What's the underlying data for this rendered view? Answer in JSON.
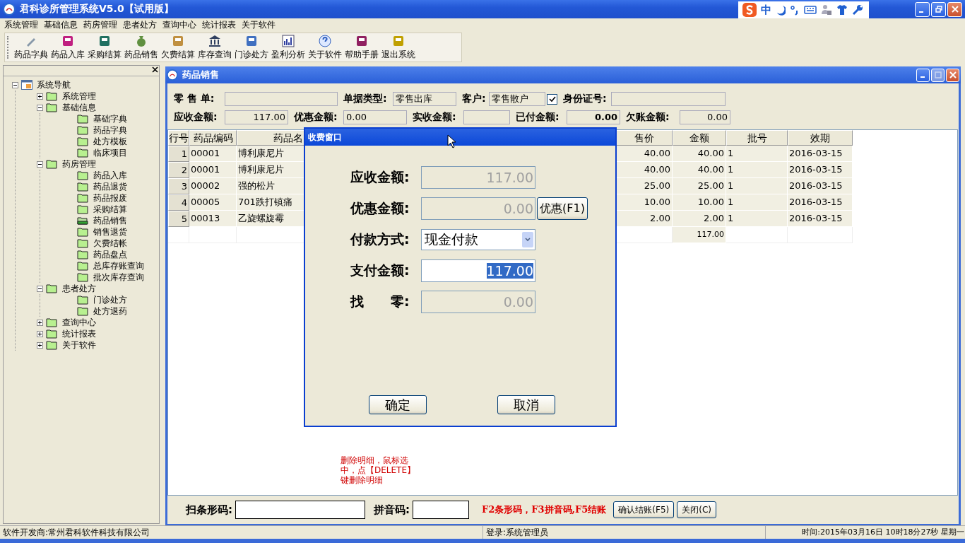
{
  "window": {
    "title": "君科诊所管理系统V5.0【试用版】"
  },
  "ime_bar": {
    "mode": "中"
  },
  "menu": [
    "系统管理",
    "基础信息",
    "药房管理",
    "患者处方",
    "查询中心",
    "统计报表",
    "关于软件"
  ],
  "toolbar": [
    "药品字典",
    "药品入库",
    "采购结算",
    "药品销售",
    "欠费结算",
    "库存查询",
    "门诊处方",
    "盈利分析",
    "关于软件",
    "帮助手册",
    "退出系统"
  ],
  "nav": {
    "label": "系统导航",
    "expanded": true,
    "children": [
      {
        "label": "系统管理",
        "expanded": false,
        "selected": false
      },
      {
        "label": "基础信息",
        "expanded": true,
        "selected": false,
        "children": [
          {
            "label": "基础字典",
            "selected": false
          },
          {
            "label": "药品字典",
            "selected": false
          },
          {
            "label": "处方模板",
            "selected": false
          },
          {
            "label": "临床项目",
            "selected": false
          }
        ]
      },
      {
        "label": "药房管理",
        "expanded": true,
        "selected": false,
        "children": [
          {
            "label": "药品入库",
            "selected": false
          },
          {
            "label": "药品退货",
            "selected": false
          },
          {
            "label": "药品报废",
            "selected": false
          },
          {
            "label": "采购结算",
            "selected": false
          },
          {
            "label": "药品销售",
            "selected": true
          },
          {
            "label": "销售退货",
            "selected": false
          },
          {
            "label": "欠费结帐",
            "selected": false
          },
          {
            "label": "药品盘点",
            "selected": false
          },
          {
            "label": "总库存账查询",
            "selected": false
          },
          {
            "label": "批次库存查询",
            "selected": false
          }
        ]
      },
      {
        "label": "患者处方",
        "expanded": true,
        "selected": false,
        "children": [
          {
            "label": "门诊处方",
            "selected": false
          },
          {
            "label": "处方退药",
            "selected": false
          }
        ]
      },
      {
        "label": "查询中心",
        "expanded": false,
        "selected": false
      },
      {
        "label": "统计报表",
        "expanded": false,
        "selected": false
      },
      {
        "label": "关于软件",
        "expanded": false,
        "selected": false
      }
    ]
  },
  "sales_window": {
    "title": "药品销售",
    "header_rows": [
      [
        {
          "kind": "text_field",
          "label": "零 售 单:"
        },
        {
          "kind": "text_field",
          "label": "单据类型:",
          "value": "零售出库"
        },
        {
          "kind": "text_field",
          "label": "客户:",
          "value": "零售散户"
        },
        {
          "kind": "checkbox",
          "checked": true
        },
        {
          "kind": "text_field",
          "label": "身份证号:"
        }
      ],
      [
        {
          "kind": "amount_field",
          "label": "应收金额:",
          "value": "117.00"
        },
        {
          "kind": "text_field",
          "label": "优惠金额:",
          "value": "0.00"
        },
        {
          "kind": "text_field",
          "label": "实收金额:"
        },
        {
          "kind": "bold_amount_field",
          "label": "已付金额:",
          "value": "0.00"
        },
        {
          "kind": "amount_field",
          "label": "欠账金额:",
          "value": "0.00"
        }
      ]
    ],
    "table": {
      "columns": [
        "行号",
        "药品编码",
        "药品名",
        "售价",
        "金额",
        "批号",
        "效期"
      ],
      "rows": [
        {
          "no": "1",
          "code": "00001",
          "name": "博利康尼片",
          "price": "40.00",
          "amount": "40.00",
          "batch": "1",
          "expiry": "2016-03-15"
        },
        {
          "no": "2",
          "code": "00001",
          "name": "博利康尼片",
          "price": "40.00",
          "amount": "40.00",
          "batch": "1",
          "expiry": "2016-03-15"
        },
        {
          "no": "3",
          "code": "00002",
          "name": "强的松片",
          "price": "25.00",
          "amount": "25.00",
          "batch": "1",
          "expiry": "2016-03-15"
        },
        {
          "no": "4",
          "code": "00005",
          "name": "701跌打镇痛",
          "price": "10.00",
          "amount": "10.00",
          "batch": "1",
          "expiry": "2016-03-15"
        },
        {
          "no": "5",
          "code": "00013",
          "name": "乙旋螺旋霉",
          "price": "2.00",
          "amount": "2.00",
          "batch": "1",
          "expiry": "2016-03-15"
        }
      ],
      "total": "117.00"
    },
    "note": "删除明细，鼠标选中，点【DELETE】键删除明细",
    "barcode": {
      "label": "扫条形码:"
    },
    "pinyin": {
      "label": "拼音码:"
    },
    "hotkeys": "F2条形码，F3拼音码,F5结账",
    "buttons": [
      "确认结账(F5)",
      "关闭(C)"
    ]
  },
  "payment_dialog": {
    "title": "收费窗口",
    "fields": [
      {
        "kind": "readonly",
        "label": "应收金额:",
        "value": "117.00"
      },
      {
        "kind": "readonly",
        "label": "优惠金额:",
        "value": "0.00",
        "button": "优惠(F1)"
      },
      {
        "kind": "select",
        "label": "付款方式:",
        "value": "现金付款"
      },
      {
        "kind": "input",
        "label": "支付金额:",
        "value": "117.00",
        "text_selected": true
      },
      {
        "kind": "readonly",
        "label": "找　　零:",
        "value": "0.00"
      }
    ],
    "buttons": [
      "确定",
      "取消"
    ]
  },
  "status_bar": [
    "软件开发商:常州君科软件科技有限公司",
    "登录:系统管理员",
    "时间:2015年03月16日 10时18分27秒 星期一"
  ]
}
